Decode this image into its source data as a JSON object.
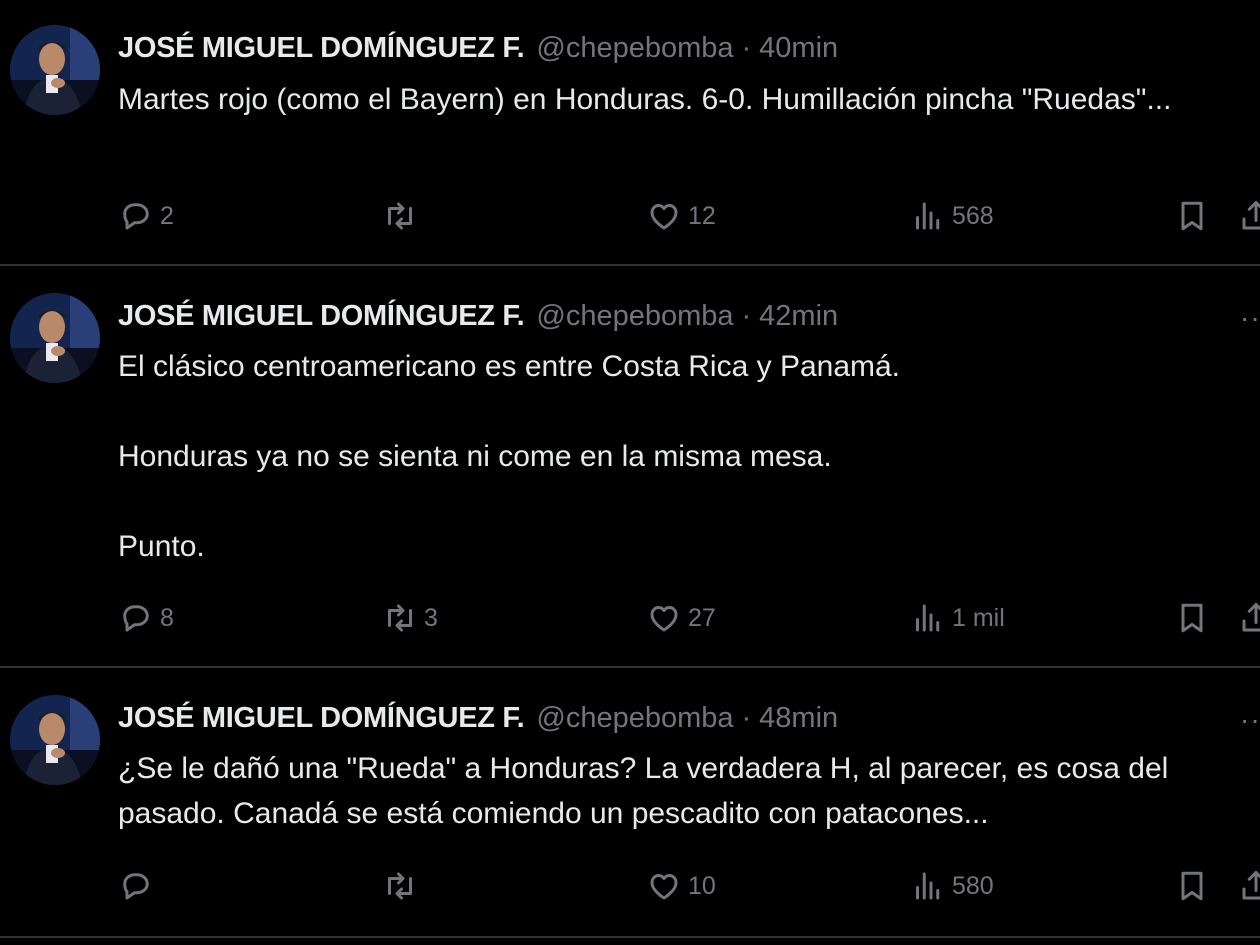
{
  "colors": {
    "background": "#000000",
    "primary_text": "#e7e9ea",
    "secondary_text": "#71767b",
    "divider": "#2f3336"
  },
  "tweets": [
    {
      "name": "JOSÉ MIGUEL DOMÍNGUEZ F.",
      "handle": "@chepebomba",
      "separator": "·",
      "time": "40min",
      "paragraphs": [
        "Martes rojo (como el Bayern) en Honduras. 6-0. Humillación pincha \"Ruedas\"..."
      ],
      "replies": "2",
      "retweets": "",
      "likes": "12",
      "views": "568"
    },
    {
      "name": "JOSÉ MIGUEL DOMÍNGUEZ F.",
      "handle": "@chepebomba",
      "separator": "·",
      "time": "42min",
      "more": "··",
      "paragraphs": [
        "El clásico centroamericano es entre Costa Rica y Panamá.",
        "Honduras ya no se sienta ni come en la misma mesa.",
        "Punto."
      ],
      "replies": "8",
      "retweets": "3",
      "likes": "27",
      "views": "1 mil"
    },
    {
      "name": "JOSÉ MIGUEL DOMÍNGUEZ F.",
      "handle": "@chepebomba",
      "separator": "·",
      "time": "48min",
      "more": "··",
      "paragraphs": [
        "¿Se le dañó una \"Rueda\" a Honduras? La verdadera H, al parecer, es cosa del pasado. Canadá se está comiendo un pescadito con patacones..."
      ],
      "replies": "",
      "retweets": "",
      "likes": "10",
      "views": "580"
    }
  ],
  "icons": [
    "avatar",
    "reply-icon",
    "retweet-icon",
    "like-icon",
    "views-icon",
    "bookmark-icon",
    "share-icon",
    "more-icon"
  ]
}
